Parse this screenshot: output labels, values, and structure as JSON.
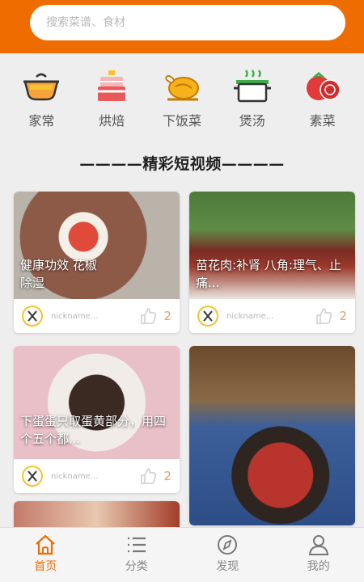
{
  "search": {
    "placeholder": "搜索菜谱、食材"
  },
  "categories": [
    {
      "label": "家常",
      "icon": "pot-icon"
    },
    {
      "label": "烘焙",
      "icon": "cake-icon"
    },
    {
      "label": "下饭菜",
      "icon": "roast-chicken-icon"
    },
    {
      "label": "煲汤",
      "icon": "soup-pot-icon"
    },
    {
      "label": "素菜",
      "icon": "tomato-icon"
    }
  ],
  "section_title": "————精彩短视频————",
  "videos": [
    {
      "caption": "健康功效 花椒除湿",
      "nickname": "nickname...",
      "likes": "2"
    },
    {
      "caption": "苗花肉:补肾 八角:理气、止痛...",
      "nickname": "nickname...",
      "likes": "2"
    },
    {
      "caption": "下蛋蛋只取蛋黄部分，用四个五个都...",
      "nickname": "nickname...",
      "likes": "2"
    },
    {
      "caption": "",
      "nickname": "",
      "likes": ""
    }
  ],
  "tabs": [
    {
      "label": "首页",
      "icon": "home-icon",
      "active": true
    },
    {
      "label": "分类",
      "icon": "list-icon"
    },
    {
      "label": "发现",
      "icon": "compass-icon"
    },
    {
      "label": "我的",
      "icon": "user-icon"
    }
  ],
  "colors": {
    "accent": "#ef6c00",
    "like": "#e0a060",
    "avatar_ring": "#f3c332"
  }
}
